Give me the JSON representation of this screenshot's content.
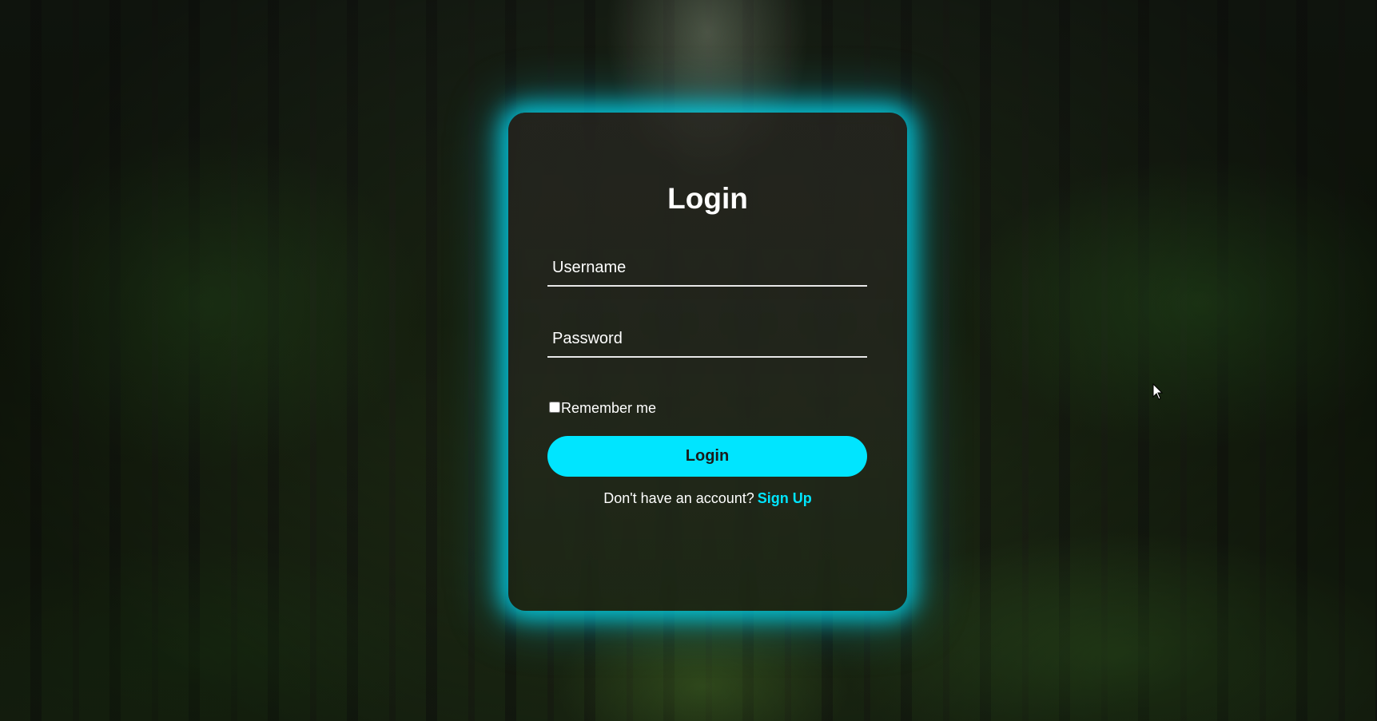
{
  "login_card": {
    "title": "Login",
    "username_placeholder": "Username",
    "password_placeholder": "Password",
    "remember_label": "Remember me",
    "remember_checked": false,
    "submit_label": "Login",
    "signup_prompt": "Don't have an account?",
    "signup_link": "Sign Up"
  },
  "colors": {
    "accent": "#00e5ff",
    "text": "#ffffff",
    "button_text": "#1a1a1a"
  },
  "icons": {
    "cursor": "mouse-pointer-icon"
  }
}
